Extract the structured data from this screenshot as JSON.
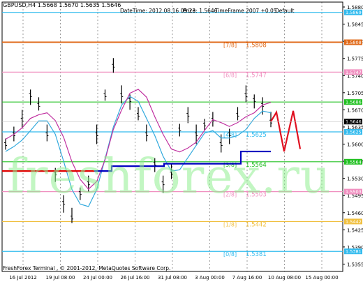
{
  "header": {
    "symbol_info": "GBPUSD,H4  1.5668 1.5670 1.5635 1.5646",
    "datetime": "DateTime: 2012.08.16 09:23",
    "price": "Price: 1.5646",
    "timeframe": "TimeFrame 2007 +0.05",
    "template": "Default"
  },
  "footer": {
    "copyright": "FreshForex Terminal , © 2001-2012, MetaQuotes Software Corp."
  },
  "watermark": "freshforex.ru",
  "colors": {
    "axis": "#000000",
    "grid": "#000000",
    "murray_orange": "#e06a1a",
    "murray_pink": "#f090c0",
    "murray_green": "#22c022",
    "murray_cyan": "#33bbee",
    "murray_yellow": "#f0c040",
    "forecast": "#e01020",
    "price_bars": "#000000",
    "ma_cyan": "#33aadd",
    "ma_magenta": "#c030a0",
    "trend_blue": "#0000c0",
    "trend_red": "#e00000"
  },
  "chart_data": {
    "type": "line",
    "series": [
      {
        "values": [
          1.56,
          1.562,
          1.565,
          1.57,
          1.568,
          1.562,
          1.554,
          1.548,
          1.545,
          1.55,
          1.552,
          1.562,
          1.57,
          1.576,
          1.57,
          1.569,
          1.566,
          1.562,
          1.556,
          1.552,
          1.554,
          1.563,
          1.566,
          1.562,
          1.564,
          1.565,
          1.56,
          1.562,
          1.566,
          1.57,
          1.569,
          1.568,
          1.5646
        ]
      }
    ],
    "x_tick_labels": [
      "16 Jul 2012",
      "19 Jul 08:00",
      "24 Jul 00:00",
      "26 Jul 16:00",
      "31 Jul 08:00",
      "3 Aug 00:00",
      "7 Aug 16:00",
      "10 Aug 08:00",
      "15 Aug 00:00"
    ],
    "y_tick_labels": [
      "1.5880",
      "1.5845",
      "1.5810",
      "1.5775",
      "1.5740",
      "1.5705",
      "1.5670",
      "1.5635",
      "1.5600",
      "1.5565",
      "1.5530",
      "1.5495",
      "1.5460",
      "1.5425",
      "1.5390",
      "1.5355"
    ],
    "ylim": [
      1.534,
      1.589
    ],
    "murray_levels": [
      {
        "label": "[8/8]",
        "value": "1.5869",
        "y": 1.5869,
        "color_key": "murray_cyan",
        "show_inline": false
      },
      {
        "label": "[7/8]",
        "value": "1.5808",
        "y": 1.5808,
        "color_key": "murray_orange"
      },
      {
        "label": "[6/8]",
        "value": "1.5747",
        "y": 1.5747,
        "color_key": "murray_pink"
      },
      {
        "label": "[5/8]",
        "value": "1.5686",
        "y": 1.5686,
        "color_key": "murray_green",
        "show_inline": false
      },
      {
        "label": "[4/8]",
        "value": "1.5625",
        "y": 1.5625,
        "color_key": "murray_cyan"
      },
      {
        "label": "[3/8]",
        "value": "1.5564",
        "y": 1.5564,
        "color_key": "murray_green"
      },
      {
        "label": "[2/8]",
        "value": "1.5503",
        "y": 1.5503,
        "color_key": "murray_pink"
      },
      {
        "label": "[1/8]",
        "value": "1.5442",
        "y": 1.5442,
        "color_key": "murray_yellow"
      },
      {
        "label": "[0/8]",
        "value": "1.5381",
        "y": 1.5381,
        "color_key": "murray_cyan"
      }
    ],
    "current_price": "1.5646",
    "grid": true
  }
}
